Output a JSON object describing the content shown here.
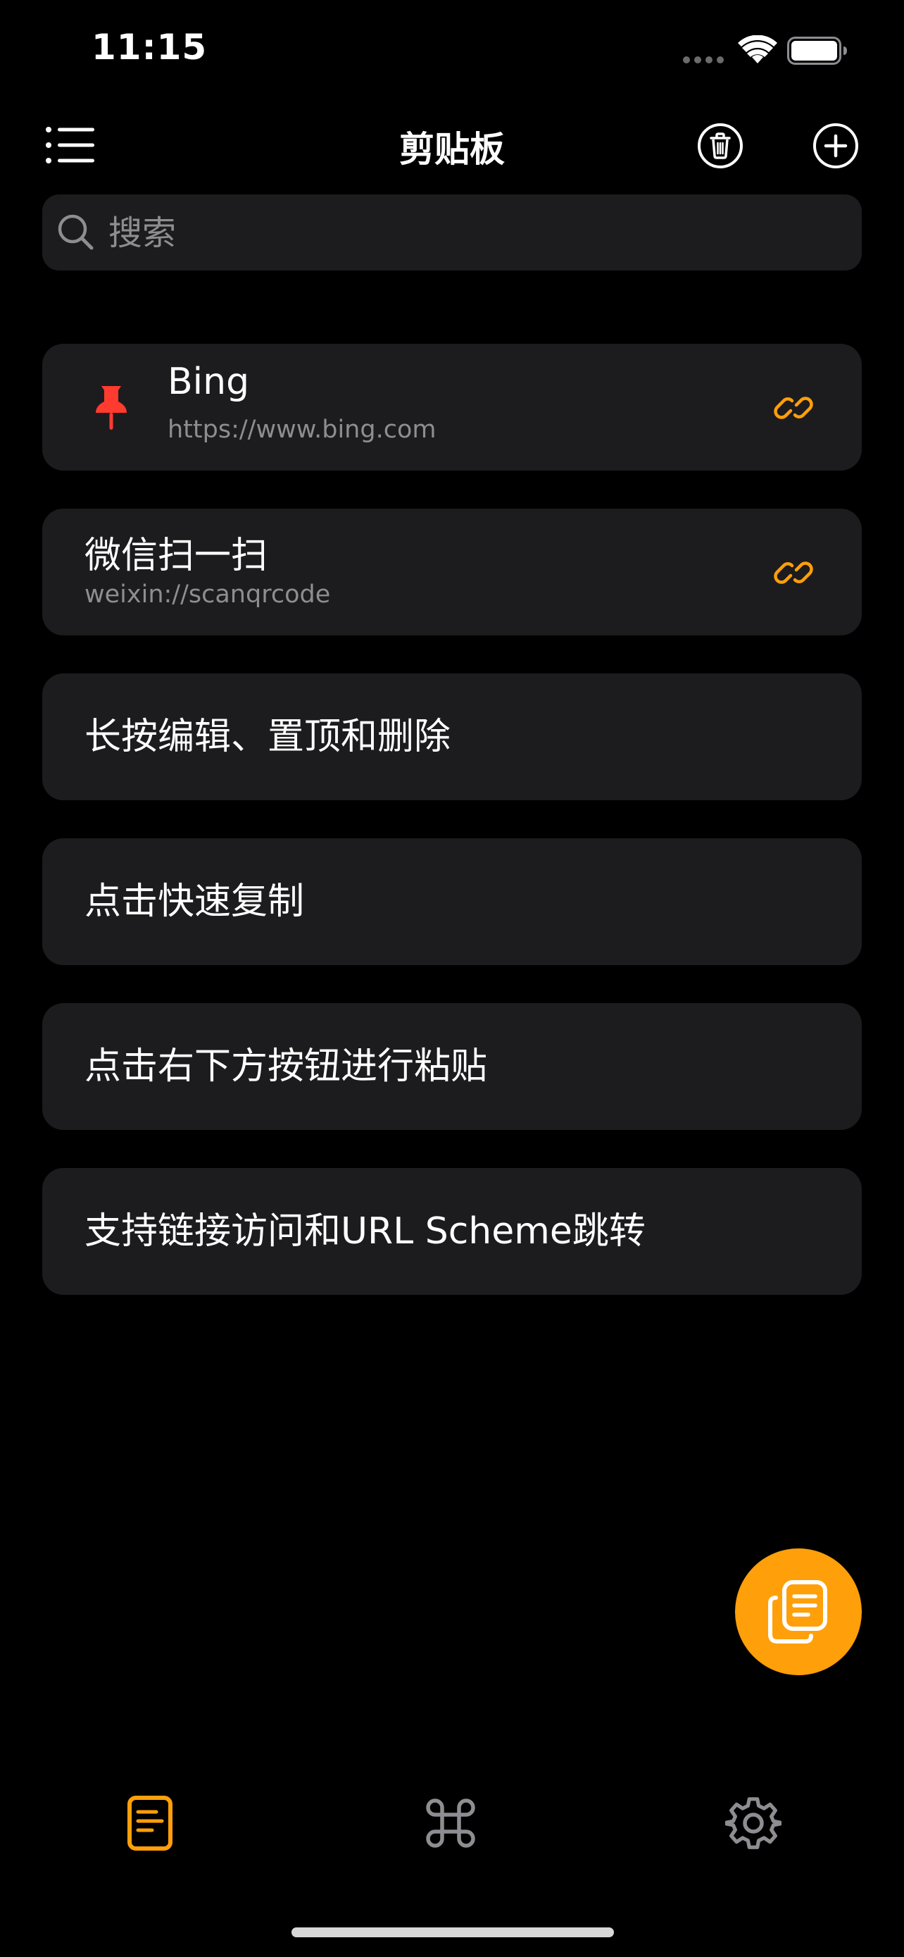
{
  "status_bar": {
    "time": "11:15"
  },
  "nav": {
    "title": "剪贴板",
    "menu_icon": "list-icon",
    "trash_icon": "trash-icon",
    "add_icon": "plus-circle-icon"
  },
  "search": {
    "placeholder": "搜索",
    "value": ""
  },
  "items": [
    {
      "title": "Bing",
      "subtitle": "https://www.bing.com",
      "pinned": true,
      "link": true
    },
    {
      "title": "微信扫一扫",
      "subtitle": "weixin://scanqrcode",
      "pinned": false,
      "link": true
    },
    {
      "title": "长按编辑、置顶和删除"
    },
    {
      "title": "点击快速复制"
    },
    {
      "title": "点击右下方按钮进行粘贴"
    },
    {
      "title": "支持链接访问和URL Scheme跳转"
    }
  ],
  "fab": {
    "icon": "paste-icon"
  },
  "tabs": [
    {
      "icon": "clipboard-icon",
      "active": true
    },
    {
      "icon": "command-icon",
      "active": false
    },
    {
      "icon": "gear-icon",
      "active": false
    }
  ],
  "colors": {
    "accent": "#ff9f0a",
    "pin": "#ff3b30",
    "card": "#1c1c1e",
    "background": "#000000",
    "secondary_text": "#8d8d92"
  }
}
